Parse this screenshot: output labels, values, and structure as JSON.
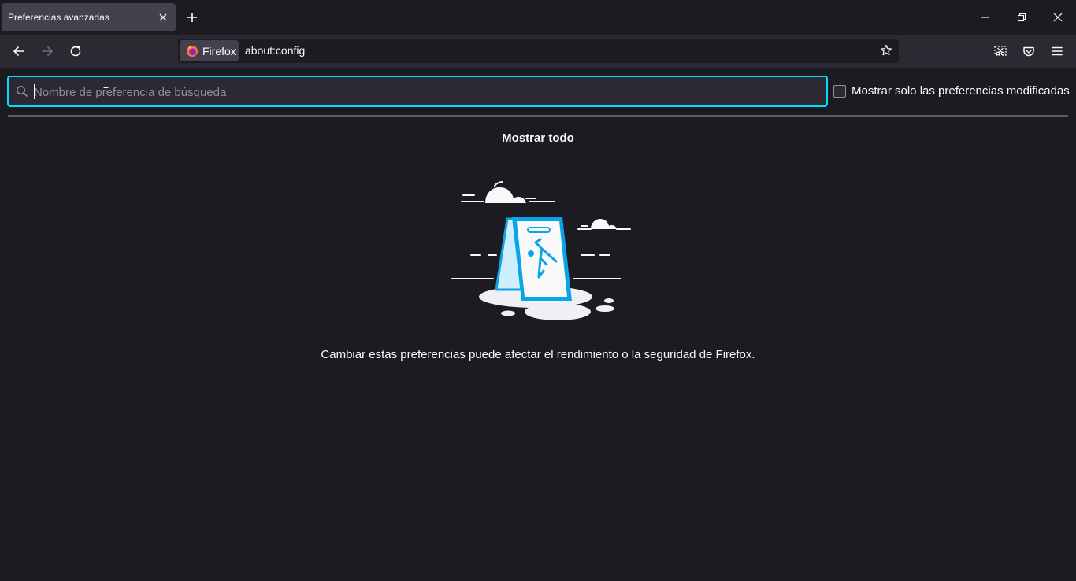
{
  "tab": {
    "title": "Preferencias avanzadas"
  },
  "nav": {
    "identity_label": "Firefox",
    "url": "about:config"
  },
  "content": {
    "search_placeholder": "Nombre de preferencia de búsqueda",
    "search_value": "",
    "only_modified_label": "Mostrar solo las preferencias modificadas",
    "only_modified_checked": false,
    "show_all_label": "Mostrar todo",
    "warning_text": "Cambiar estas preferencias puede afectar el rendimiento o la seguridad de Firefox."
  },
  "colors": {
    "background": "#1c1b22",
    "toolbar": "#2b2a33",
    "tab_active": "#42414d",
    "focus_ring": "#00ddff",
    "illustration_blue": "#0aa5e8",
    "text": "#fbfbfe"
  },
  "icons": {
    "tab_close": "close-icon",
    "new_tab": "plus-icon",
    "minimize": "minimize-icon",
    "restore": "restore-icon",
    "close_window": "close-icon",
    "back": "arrow-left-icon",
    "forward": "arrow-right-icon",
    "reload": "reload-icon",
    "identity": "firefox-logo-icon",
    "bookmark": "star-icon",
    "screenshot": "screenshot-icon",
    "pocket": "pocket-icon",
    "menu": "hamburger-menu-icon",
    "search": "search-icon"
  }
}
